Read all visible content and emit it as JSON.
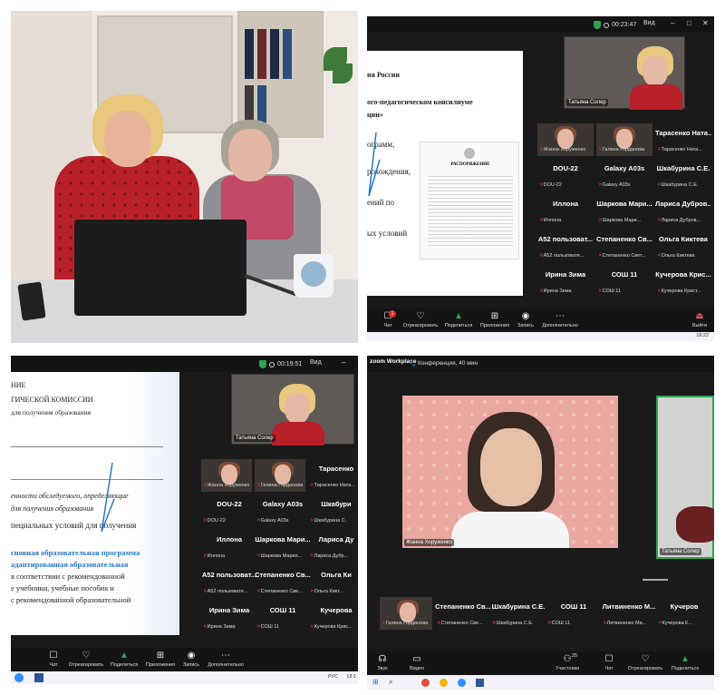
{
  "panel2": {
    "timer": "00:23:47",
    "view_label": "Вид",
    "doc_lines": [
      "ия России",
      "ого-педагогическом консилиуме",
      "ции»",
      "ограмм,",
      "рохождения,",
      "ений по",
      "ых условий"
    ],
    "doc_stamp": "РАСПОРЯЖЕНИЕ",
    "selfview_name": "Татьяна Солер",
    "grid": [
      {
        "type": "video",
        "name": "Жанна Хоруженко"
      },
      {
        "type": "video",
        "name": "Галина Горданова"
      },
      {
        "type": "name",
        "big": "Тарасенко Ната...",
        "small": "Тарасенко Ната..."
      },
      {
        "type": "name",
        "big": "DOU-22",
        "small": "DOU-22"
      },
      {
        "type": "name",
        "big": "Galaxy A03s",
        "small": "Galaxy A03s"
      },
      {
        "type": "name",
        "big": "Шкабурина С.Е.",
        "small": "Шкабурина С.Е."
      },
      {
        "type": "name",
        "big": "Иллона",
        "small": "Иллона"
      },
      {
        "type": "name",
        "big": "Шаркова Мари...",
        "small": "Шаркова Мари..."
      },
      {
        "type": "name",
        "big": "Лариса Дубров...",
        "small": "Лариса Дубров..."
      },
      {
        "type": "name",
        "big": "А52 пользоват...",
        "small": "А52 пользовате..."
      },
      {
        "type": "name",
        "big": "Степаненко Св...",
        "small": "Степаненко Свет..."
      },
      {
        "type": "name",
        "big": "Ольга Киктева",
        "small": "Ольга Киктева"
      },
      {
        "type": "name",
        "big": "Ирина Зима",
        "small": "Ирина Зима"
      },
      {
        "type": "name",
        "big": "СОШ 11",
        "small": "СОШ 11"
      },
      {
        "type": "name",
        "big": "Кучерова Крис...",
        "small": "Кучерова Крист..."
      }
    ],
    "toolbar": [
      "Чат",
      "Отреагировать",
      "Поделиться",
      "Приложения",
      "Запись",
      "Дополнительно"
    ],
    "exit_label": "Выйти",
    "chat_badge": "1",
    "clock": "18:22"
  },
  "panel3": {
    "timer": "00:19:51",
    "view_label": "Вид",
    "doc_lines": [
      "НИЕ",
      "ГИЧЕСКОЙ КОМИССИИ",
      "для получения образования",
      "енности обследуемого, определяющие",
      "для получения образования",
      "пециальных условий для получения",
      "сновная образовательная программа",
      "адаптированная образовательная",
      "в соответствии с рекомендованной",
      "е учебники, учебные пособия и",
      "с рекомендованной образовательной"
    ],
    "selfview_name": "Татьяна Солер",
    "grid": [
      {
        "type": "video",
        "name": "Жанна Хоруженко"
      },
      {
        "type": "video",
        "name": "Галина Горданова"
      },
      {
        "type": "name",
        "big": "Тарасенко",
        "small": "Тарасенко Ната..."
      },
      {
        "type": "name",
        "big": "DOU-22",
        "small": "DOU-22"
      },
      {
        "type": "name",
        "big": "Galaxy A03s",
        "small": "Galaxy A03s"
      },
      {
        "type": "name",
        "big": "Шкабури",
        "small": "Шкабурина С."
      },
      {
        "type": "name",
        "big": "Иллона",
        "small": "Иллона"
      },
      {
        "type": "name",
        "big": "Шаркова Мари...",
        "small": "Шаркова Мария..."
      },
      {
        "type": "name",
        "big": "Лариса Ду",
        "small": "Лариса Дубр..."
      },
      {
        "type": "name",
        "big": "А52 пользоват...",
        "small": "А52 пользовате..."
      },
      {
        "type": "name",
        "big": "Степаненко Св...",
        "small": "Степаненко Све..."
      },
      {
        "type": "name",
        "big": "Ольга Ки",
        "small": "Ольга Кикт..."
      },
      {
        "type": "name",
        "big": "Ирина Зима",
        "small": "Ирина Зима"
      },
      {
        "type": "name",
        "big": "СОШ 11",
        "small": "СОШ 11"
      },
      {
        "type": "name",
        "big": "Кучерова",
        "small": "Кучерова Крис..."
      }
    ],
    "toolbar": [
      "Чат",
      "Отреагировать",
      "Поделиться",
      "Приложения",
      "Запись",
      "Дополнительно"
    ],
    "lang": "РУС",
    "clock": "18:1"
  },
  "panel4": {
    "app_name": "zoom Workplace",
    "conference": "Конференция, 40 мин",
    "speaker_name": "Жанна Хоруженко",
    "side_name": "Татьяна Солер",
    "strip": [
      {
        "type": "video",
        "name": "Галина Горданова"
      },
      {
        "type": "name",
        "big": "Степаненко Св...",
        "small": "Степаненко Све..."
      },
      {
        "type": "name",
        "big": "Шкабурина С.Е.",
        "small": "Шкабурина С.Е."
      },
      {
        "type": "name",
        "big": "СОШ 11",
        "small": "СОШ 11"
      },
      {
        "type": "name",
        "big": "Литвиненко М...",
        "small": "Литвиненко Ма..."
      },
      {
        "type": "name",
        "big": "Кучеров",
        "small": "Кучерова К..."
      }
    ],
    "toolbar": [
      "Звук",
      "Видео",
      "Участники",
      "Чат",
      "Отреагировать",
      "Поделиться"
    ],
    "participants_count": "25"
  },
  "colors": {
    "zoom_dark": "#1a1a1a",
    "accent_green": "#2ea44f",
    "muted_red": "#e03b3b",
    "doc_blue": "#2a78c5"
  }
}
